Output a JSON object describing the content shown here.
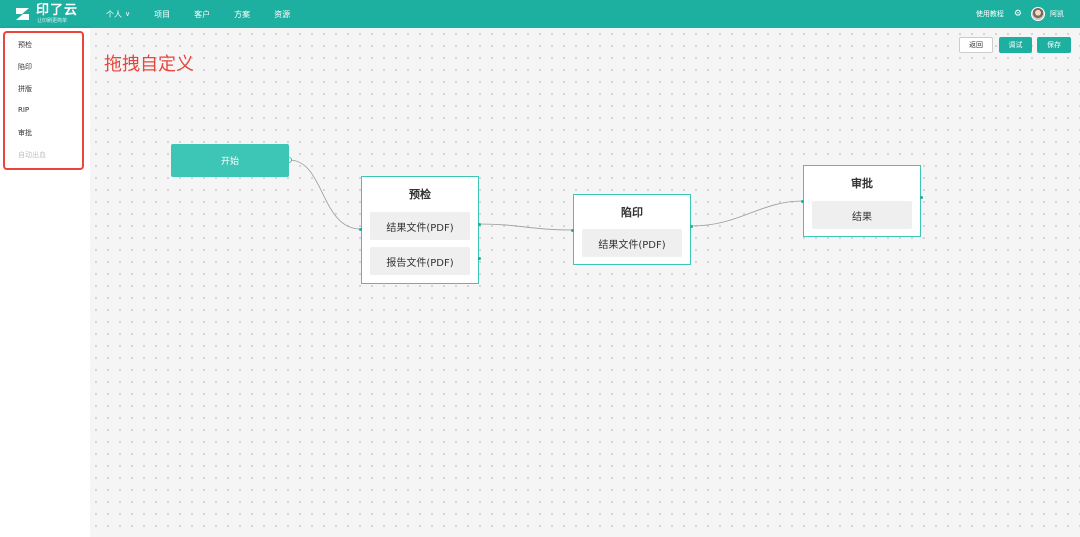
{
  "header": {
    "logo_name": "印了云",
    "logo_sub": "让印刷更简单",
    "nav": [
      {
        "label": "个人",
        "has_dropdown": true
      },
      {
        "label": "项目"
      },
      {
        "label": "客户"
      },
      {
        "label": "方案"
      },
      {
        "label": "资源"
      }
    ],
    "help_label": "使用教程",
    "user_name": "阿凯"
  },
  "sidebar": {
    "items": [
      {
        "label": "预检",
        "enabled": true
      },
      {
        "label": "陷印",
        "enabled": true
      },
      {
        "label": "拼版",
        "enabled": true
      },
      {
        "label": "RIP",
        "enabled": true
      },
      {
        "label": "审批",
        "enabled": true
      },
      {
        "label": "自动出血",
        "enabled": false
      }
    ]
  },
  "canvas": {
    "annotation": "拖拽自定义",
    "toolbar": {
      "back": "返回",
      "debug": "调试",
      "save": "保存"
    },
    "start_node": {
      "label": "开始"
    },
    "nodes": {
      "precheck": {
        "title": "预检",
        "ports": [
          "结果文件(PDF)",
          "报告文件(PDF)"
        ]
      },
      "trap": {
        "title": "陷印",
        "ports": [
          "结果文件(PDF)"
        ]
      },
      "approve": {
        "title": "审批",
        "ports": [
          "结果"
        ]
      }
    }
  },
  "colors": {
    "brand": "#1dafa0",
    "node_start": "#3dc5b5",
    "highlight": "#e8453c"
  }
}
